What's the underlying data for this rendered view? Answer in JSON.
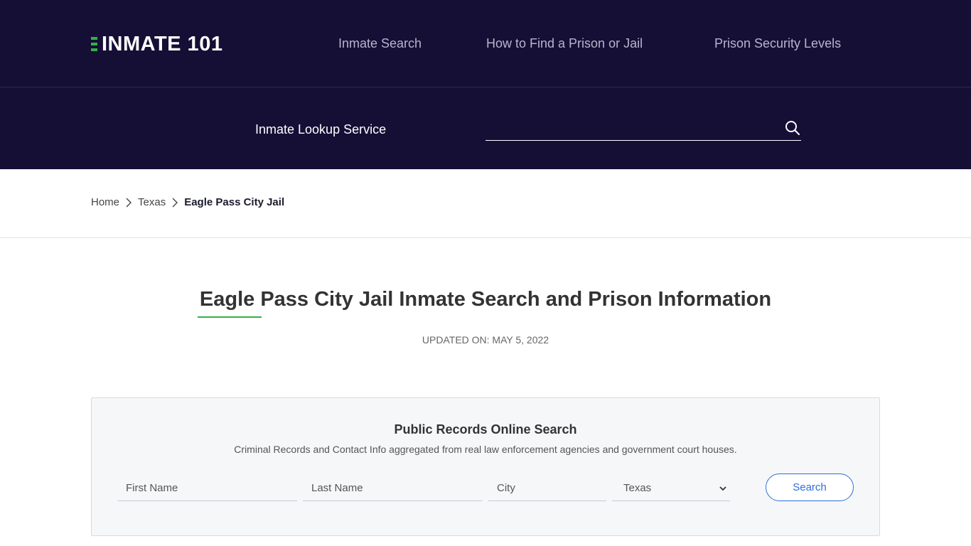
{
  "header": {
    "logo_text": "INMATE 101",
    "nav": [
      {
        "label": "Inmate Search"
      },
      {
        "label": "How to Find a Prison or Jail"
      },
      {
        "label": "Prison Security Levels"
      }
    ]
  },
  "lookup": {
    "label": "Inmate Lookup Service",
    "search_value": "",
    "search_icon": "search-icon"
  },
  "breadcrumb": {
    "home": "Home",
    "state": "Texas",
    "current": "Eagle Pass City Jail"
  },
  "page": {
    "title": "Eagle Pass City Jail Inmate Search and Prison Information",
    "updated": "UPDATED ON: MAY 5, 2022"
  },
  "records": {
    "title": "Public Records Online Search",
    "subtitle": "Criminal Records and Contact Info aggregated from real law enforcement agencies and government court houses.",
    "first_name_placeholder": "First Name",
    "last_name_placeholder": "Last Name",
    "city_placeholder": "City",
    "state_selected": "Texas",
    "search_label": "Search"
  },
  "colors": {
    "header_bg": "#150f36",
    "accent_green": "#2fb344",
    "button_blue": "#2e6fd8"
  }
}
